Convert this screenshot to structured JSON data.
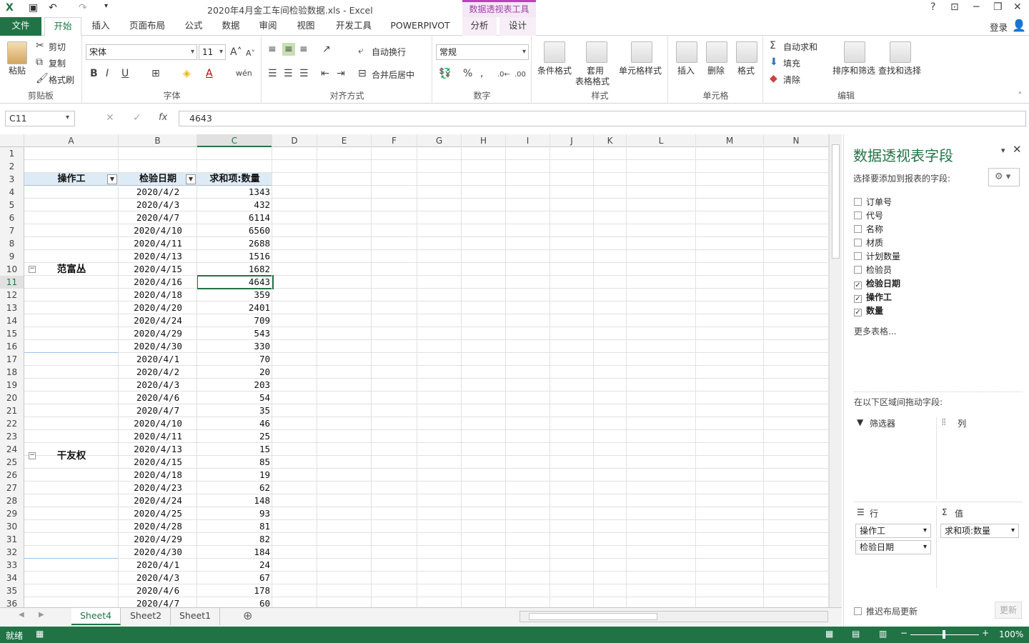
{
  "titlebar": {
    "title": "2020年4月金工车间检验数据.xls - Excel",
    "context_tool": "数据透视表工具",
    "help": "?",
    "win_min": "─",
    "win_restore": "❐",
    "win_close": "✕"
  },
  "tabs": {
    "file": "文件",
    "home": "开始",
    "insert": "插入",
    "layout": "页面布局",
    "formulas": "公式",
    "data": "数据",
    "review": "审阅",
    "view": "视图",
    "developer": "开发工具",
    "powerpivot": "POWERPIVOT",
    "analyze": "分析",
    "design": "设计",
    "login": "登录"
  },
  "ribbon": {
    "clipboard": {
      "paste": "粘贴",
      "cut": "剪切",
      "copy": "复制",
      "format_painter": "格式刷",
      "label": "剪贴板"
    },
    "font": {
      "name": "宋体",
      "size": "11",
      "label": "字体",
      "bold": "B",
      "italic": "I",
      "underline": "U"
    },
    "align": {
      "wrap": "自动换行",
      "merge": "合并后居中",
      "label": "对齐方式"
    },
    "number": {
      "format": "常规",
      "label": "数字"
    },
    "styles": {
      "conditional": "条件格式",
      "table_format": "套用",
      "table_format2": "表格格式",
      "cell_styles": "单元格样式",
      "label": "样式"
    },
    "cells": {
      "insert": "插入",
      "delete": "删除",
      "format": "格式",
      "label": "单元格"
    },
    "editing": {
      "autosum": "自动求和",
      "fill": "填充",
      "clear": "清除",
      "sort": "排序和筛选",
      "find": "查找和选择",
      "label": "编辑"
    }
  },
  "formula": {
    "namebox": "C11",
    "fx": "fx",
    "value": "4643"
  },
  "columns": [
    "A",
    "B",
    "C",
    "D",
    "E",
    "F",
    "G",
    "H",
    "I",
    "J",
    "K",
    "L",
    "M",
    "N"
  ],
  "pivot": {
    "header": {
      "operator": "操作工",
      "date": "检验日期",
      "sum": "求和项:数量"
    },
    "groups": [
      {
        "name": "范富丛",
        "rows": [
          [
            "2020/4/2",
            "1343"
          ],
          [
            "2020/4/3",
            "432"
          ],
          [
            "2020/4/7",
            "6114"
          ],
          [
            "2020/4/10",
            "6560"
          ],
          [
            "2020/4/11",
            "2688"
          ],
          [
            "2020/4/13",
            "1516"
          ],
          [
            "2020/4/15",
            "1682"
          ],
          [
            "2020/4/16",
            "4643"
          ],
          [
            "2020/4/18",
            "359"
          ],
          [
            "2020/4/20",
            "2401"
          ],
          [
            "2020/4/24",
            "709"
          ],
          [
            "2020/4/29",
            "543"
          ],
          [
            "2020/4/30",
            "330"
          ]
        ]
      },
      {
        "name": "干友权",
        "rows": [
          [
            "2020/4/1",
            "70"
          ],
          [
            "2020/4/2",
            "20"
          ],
          [
            "2020/4/3",
            "203"
          ],
          [
            "2020/4/6",
            "54"
          ],
          [
            "2020/4/7",
            "35"
          ],
          [
            "2020/4/10",
            "46"
          ],
          [
            "2020/4/11",
            "25"
          ],
          [
            "2020/4/13",
            "15"
          ],
          [
            "2020/4/15",
            "85"
          ],
          [
            "2020/4/18",
            "19"
          ],
          [
            "2020/4/23",
            "62"
          ],
          [
            "2020/4/24",
            "148"
          ],
          [
            "2020/4/25",
            "93"
          ],
          [
            "2020/4/28",
            "81"
          ],
          [
            "2020/4/29",
            "82"
          ],
          [
            "2020/4/30",
            "184"
          ]
        ]
      },
      {
        "name": "",
        "rows": [
          [
            "2020/4/1",
            "24"
          ],
          [
            "2020/4/3",
            "67"
          ],
          [
            "2020/4/6",
            "178"
          ],
          [
            "2020/4/7",
            "60"
          ]
        ]
      }
    ]
  },
  "sheets": [
    "Sheet4",
    "Sheet2",
    "Sheet1"
  ],
  "pane": {
    "title": "数据透视表字段",
    "choose": "选择要添加到报表的字段:",
    "fields": [
      {
        "label": "订单号",
        "checked": false
      },
      {
        "label": "代号",
        "checked": false
      },
      {
        "label": "名称",
        "checked": false
      },
      {
        "label": "材质",
        "checked": false
      },
      {
        "label": "计划数量",
        "checked": false
      },
      {
        "label": "检验员",
        "checked": false
      },
      {
        "label": "检验日期",
        "checked": true
      },
      {
        "label": "操作工",
        "checked": true
      },
      {
        "label": "数量",
        "checked": true
      }
    ],
    "more": "更多表格...",
    "drag": "在以下区域间拖动字段:",
    "filter": "筛选器",
    "columns": "列",
    "rows": "行",
    "values": "值",
    "row_items": [
      "操作工",
      "检验日期"
    ],
    "value_items": [
      "求和项:数量"
    ],
    "defer": "推迟布局更新",
    "update": "更新"
  },
  "status": {
    "ready": "就绪",
    "zoom": "100%"
  }
}
